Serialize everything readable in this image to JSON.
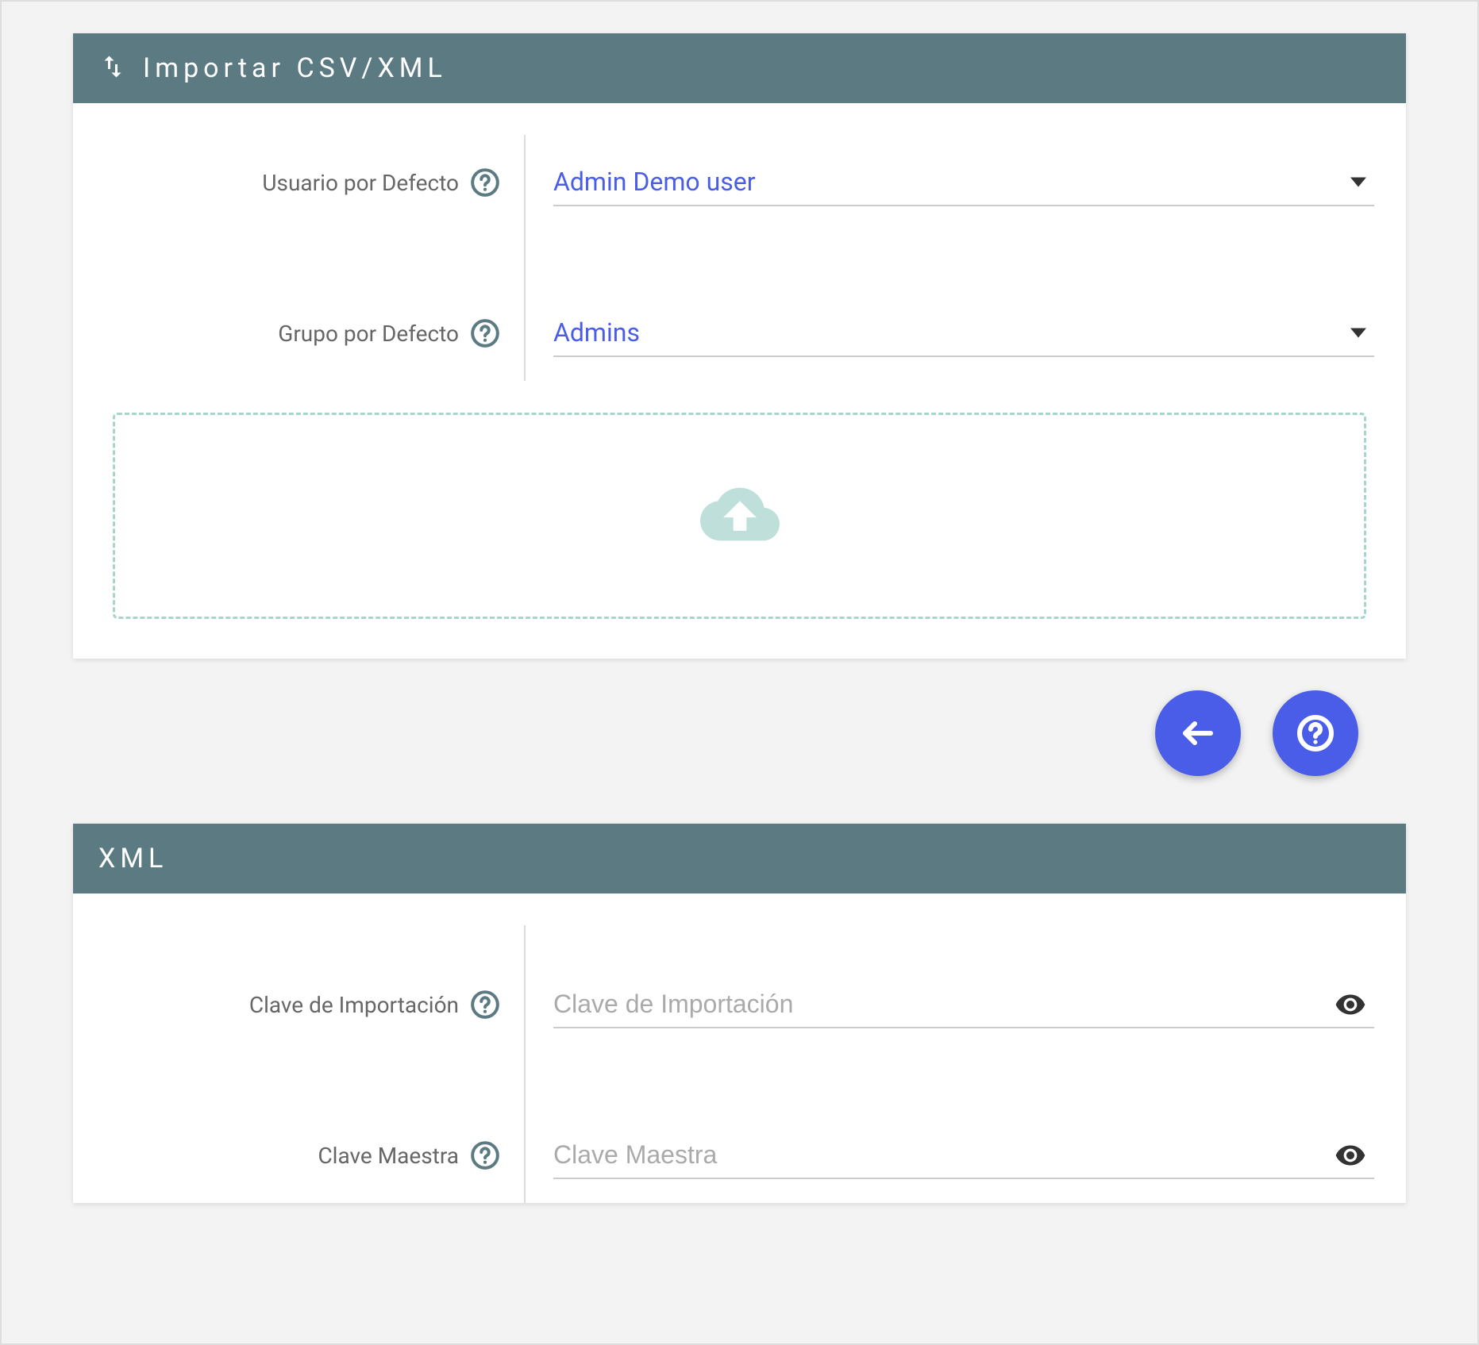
{
  "import_card": {
    "title": "Importar CSV/XML",
    "fields": {
      "default_user": {
        "label": "Usuario por Defecto",
        "value": "Admin Demo user"
      },
      "default_group": {
        "label": "Grupo por Defecto",
        "value": "Admins"
      }
    }
  },
  "xml_card": {
    "title": "XML",
    "fields": {
      "import_key": {
        "label": "Clave de Importación",
        "placeholder": "Clave de Importación"
      },
      "master_key": {
        "label": "Clave Maestra",
        "placeholder": "Clave Maestra"
      }
    }
  }
}
